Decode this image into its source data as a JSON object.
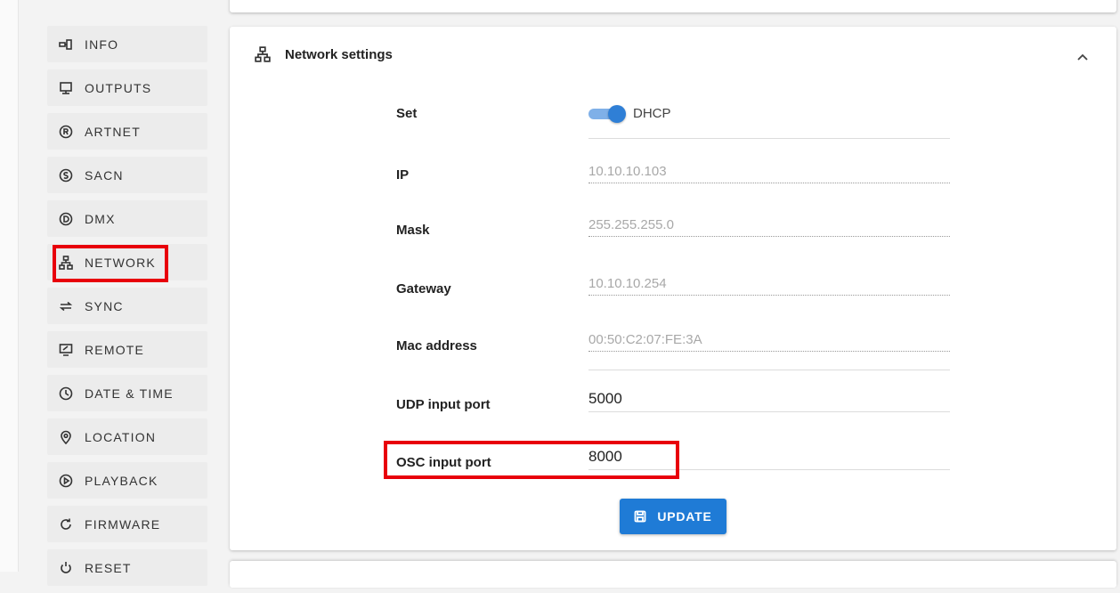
{
  "sidebar": {
    "items": [
      {
        "label": "INFO",
        "icon": "info-icon"
      },
      {
        "label": "OUTPUTS",
        "icon": "outputs-icon"
      },
      {
        "label": "ARTNET",
        "icon": "artnet-icon"
      },
      {
        "label": "SACN",
        "icon": "sacn-icon"
      },
      {
        "label": "DMX",
        "icon": "dmx-icon"
      },
      {
        "label": "NETWORK",
        "icon": "network-icon"
      },
      {
        "label": "SYNC",
        "icon": "sync-icon"
      },
      {
        "label": "REMOTE",
        "icon": "remote-icon"
      },
      {
        "label": "DATE & TIME",
        "icon": "clock-icon"
      },
      {
        "label": "LOCATION",
        "icon": "location-icon"
      },
      {
        "label": "PLAYBACK",
        "icon": "playback-icon"
      },
      {
        "label": "FIRMWARE",
        "icon": "firmware-icon"
      },
      {
        "label": "RESET",
        "icon": "reset-icon"
      }
    ]
  },
  "network": {
    "title": "Network settings",
    "set_label": "Set",
    "dhcp_label": "DHCP",
    "dhcp_enabled": true,
    "ip_label": "IP",
    "ip_value": "10.10.10.103",
    "mask_label": "Mask",
    "mask_value": "255.255.255.0",
    "gateway_label": "Gateway",
    "gateway_value": "10.10.10.254",
    "mac_label": "Mac address",
    "mac_value": "00:50:C2:07:FE:3A",
    "udp_label": "UDP input port",
    "udp_value": "5000",
    "osc_label": "OSC input port",
    "osc_value": "8000",
    "update_label": "UPDATE"
  },
  "colors": {
    "accent": "#1f7bd6",
    "highlight": "#e8000b",
    "toggle_track": "#7fb0e8"
  }
}
